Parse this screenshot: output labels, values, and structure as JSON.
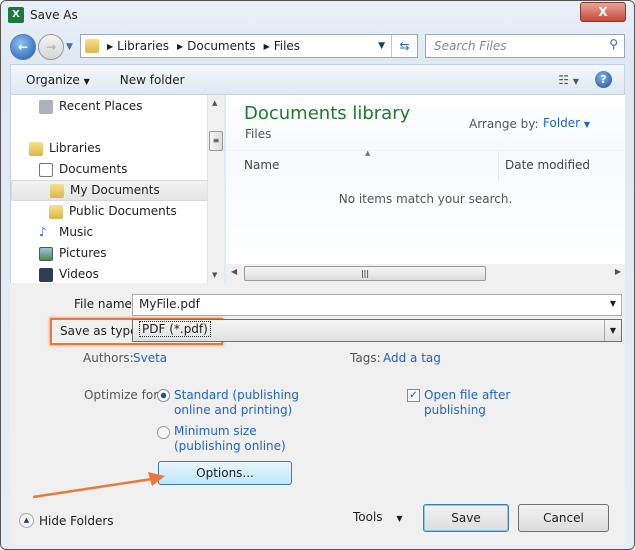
{
  "window": {
    "title": "Save As",
    "close_label": "X"
  },
  "address": {
    "segments": [
      "Libraries",
      "Documents",
      "Files"
    ],
    "search_placeholder": "Search Files"
  },
  "toolbar": {
    "organize": "Organize",
    "new_folder": "New folder"
  },
  "nav": {
    "items": [
      {
        "label": "Recent Places"
      },
      {
        "label": "Libraries"
      },
      {
        "label": "Documents"
      },
      {
        "label": "My Documents",
        "selected": true
      },
      {
        "label": "Public Documents"
      },
      {
        "label": "Music"
      },
      {
        "label": "Pictures"
      },
      {
        "label": "Videos"
      }
    ]
  },
  "content": {
    "title": "Documents library",
    "subtitle": "Files",
    "arrange_label": "Arrange by:",
    "arrange_value": "Folder",
    "columns": [
      "Name",
      "Date modified"
    ],
    "empty_message": "No items match your search."
  },
  "form": {
    "file_name_label": "File name:",
    "file_name": "MyFile.pdf",
    "type_label": "Save as type:",
    "type_value": "PDF (*.pdf)",
    "authors_label": "Authors:",
    "authors_value": "Sveta",
    "tags_label": "Tags:",
    "tags_value": "Add a tag",
    "optimize_label": "Optimize for:",
    "opt_standard": [
      "Standard (publishing",
      "online and printing)"
    ],
    "opt_min": [
      "Minimum size",
      "(publishing online)"
    ],
    "optimize_selected": "standard",
    "open_after": [
      "Open file after",
      "publishing"
    ],
    "open_after_checked": true,
    "options_button": "Options..."
  },
  "footer": {
    "hide_folders": "Hide Folders",
    "tools": "Tools",
    "save": "Save",
    "cancel": "Cancel"
  },
  "colors": {
    "highlight": "#e8793a",
    "title_green": "#1e7a2e",
    "link": "#1e64c8"
  }
}
